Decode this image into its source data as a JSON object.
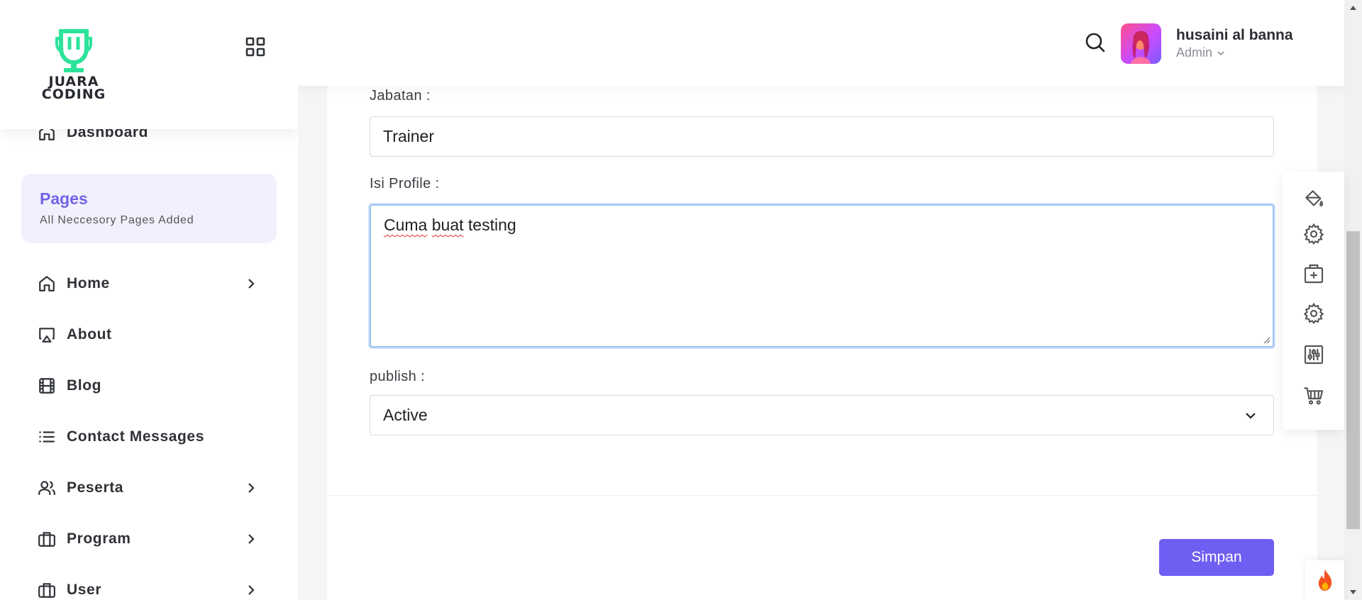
{
  "brand": {
    "logo_line1": "JUARA",
    "logo_line2": "CODING",
    "accent": "#7463e8",
    "logo_color": "#2de39a"
  },
  "sidebar": {
    "dashboard_label": "Dashboard",
    "pages_card": {
      "title": "Pages",
      "subtitle": "All Neccesory Pages Added"
    },
    "items": [
      {
        "label": "Home",
        "icon": "home-icon",
        "has_submenu": true
      },
      {
        "label": "About",
        "icon": "monitor-icon",
        "has_submenu": false
      },
      {
        "label": "Blog",
        "icon": "film-icon",
        "has_submenu": false
      },
      {
        "label": "Contact Messages",
        "icon": "list-icon",
        "has_submenu": false
      },
      {
        "label": "Peserta",
        "icon": "users-icon",
        "has_submenu": true
      },
      {
        "label": "Program",
        "icon": "briefcase-icon",
        "has_submenu": true
      },
      {
        "label": "User",
        "icon": "briefcase-icon",
        "has_submenu": true
      }
    ]
  },
  "header": {
    "user_name": "husaini al banna",
    "user_role": "Admin"
  },
  "form": {
    "jabatan_label": "Jabatan :",
    "jabatan_value": "Trainer",
    "profile_label": "Isi Profile :",
    "profile_words": [
      "Cuma",
      "buat",
      "testing"
    ],
    "publish_label": "publish :",
    "publish_value": "Active",
    "save_label": "Simpan",
    "save_color": "#6f5ef2"
  },
  "tool_panel": [
    "paint-bucket-icon",
    "gear-icon",
    "medical-box-icon",
    "gear-icon",
    "sliders-icon",
    "cart-icon"
  ]
}
